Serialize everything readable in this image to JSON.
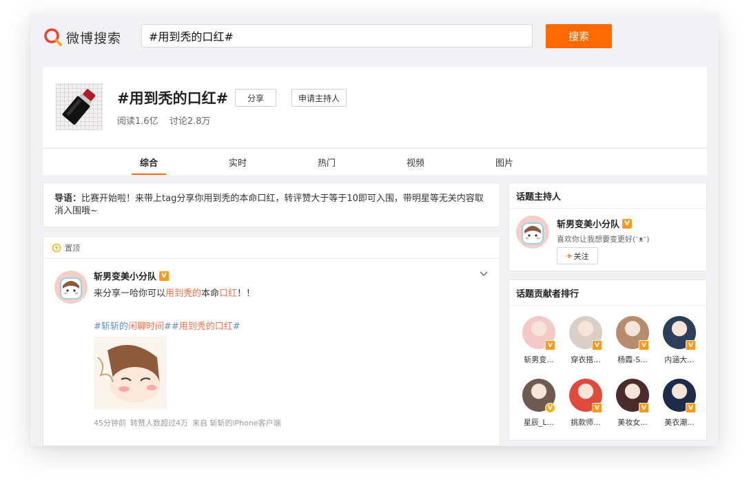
{
  "header": {
    "logo_text": "微博搜索",
    "search_value": "#用到秃的口红#",
    "search_button": "搜索"
  },
  "topic": {
    "title": "#用到秃的口红#",
    "share_button": "分享",
    "apply_host_button": "申请主持人",
    "reads": "阅读1.6亿",
    "discussions": "讨论2.8万"
  },
  "tabs": [
    "综合",
    "实时",
    "热门",
    "视频",
    "图片"
  ],
  "active_tab": "综合",
  "guide": {
    "label": "导语：",
    "text": "比赛开始啦！来带上tag分享你用到秃的本命口红，转评赞大于等于10即可入围，带明星等无关内容取消入围哦~"
  },
  "post": {
    "pin_label": "置顶",
    "author": "斩男变美小分队",
    "verified_mark": "V",
    "text_parts": [
      "来分享一哈你可以",
      "用到秃的",
      "本命",
      "口红",
      "！！"
    ],
    "tag_parts": [
      "#斩斩的",
      "闲聊时间",
      "##",
      "用到秃的口红",
      "#"
    ],
    "meta_time": "45分钟前",
    "meta_likes": "转赞人数超过4万",
    "meta_source": "来自 斩斩的iPhone客户端"
  },
  "host": {
    "title": "话题主持人",
    "name": "斩男变美小分队",
    "desc": "喜欢你让我想要变更好(ᵔᴥᵔ)",
    "follow_plus": "+",
    "follow_label": "关注"
  },
  "ranking": {
    "title": "话题贡献者排行",
    "items": [
      {
        "name": "斩男变...",
        "badge": "V",
        "avatar_color": "#f3c9c7"
      },
      {
        "name": "穿衣搭...",
        "badge": "V",
        "avatar_color": "#d9cfc8"
      },
      {
        "name": "杨霞-S...",
        "badge": "V",
        "avatar_color": "#b78b6d"
      },
      {
        "name": "内涵大...",
        "badge": "V",
        "avatar_color": "#2b3e5a"
      },
      {
        "name": "星辰_L...",
        "badge": "V",
        "avatar_color": "#6f5a52"
      },
      {
        "name": "挑款师...",
        "badge": "V",
        "avatar_color": "#e04a3c"
      },
      {
        "name": "美妆女...",
        "badge": "V",
        "avatar_color": "#4a2a2a"
      },
      {
        "name": "美衣潮...",
        "badge": "V",
        "avatar_color": "#1d2b4a"
      }
    ]
  },
  "colors": {
    "accent": "#ff6a00",
    "highlight": "#eb7350",
    "link_blue": "#5d8fc7",
    "verified": "#f59a23"
  },
  "icons": {
    "logo": "weibo-search-logo-icon",
    "pin": "pin-icon",
    "chevron": "chevron-down-icon"
  }
}
